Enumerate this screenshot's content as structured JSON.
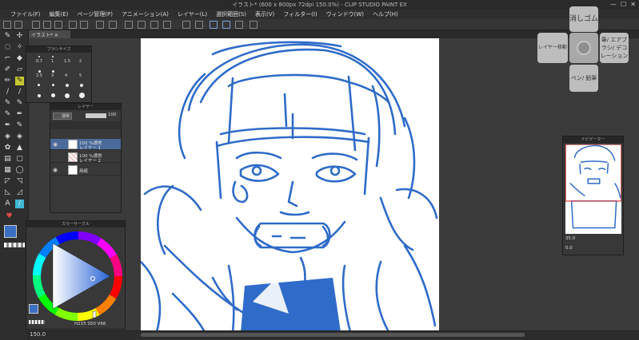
{
  "window": {
    "title": "イラスト* (600 x 800px 72dpi 150.0%) - CLIP STUDIO PAINT EX"
  },
  "menu": [
    "ファイル(F)",
    "編集(E)",
    "ページ管理(P)",
    "アニメーション(A)",
    "レイヤー(L)",
    "選択範囲(S)",
    "表示(V)",
    "フィルター(I)",
    "ウィンドウ(W)",
    "ヘルプ(H)"
  ],
  "doc_tab": "イラスト*",
  "brush_panel": {
    "title": "ブラシサイズ",
    "sizes": [
      "0.7",
      "1",
      "1.5",
      "2",
      "2.5",
      "3",
      "4",
      "5"
    ]
  },
  "layer_panel": {
    "title": "レイヤー",
    "blend": "通常",
    "opacity": "100",
    "layers": [
      {
        "percent": "100 %通常",
        "name": "レイヤー 1",
        "selected": true
      },
      {
        "percent": "100 %通常",
        "name": "レイヤー 2",
        "selected": false
      },
      {
        "percent": "",
        "name": "用紙",
        "selected": false
      }
    ]
  },
  "color_panel": {
    "title": "カラーサークル",
    "h": "215",
    "s": "50",
    "v": "66",
    "h_label": "H",
    "s_label": "S",
    "v_label": "V"
  },
  "nav_panel": {
    "title": "ナビゲーター",
    "zoom": "35.0",
    "rotate": "0.0"
  },
  "quick_access": {
    "top": "消しゴム",
    "left": "レイヤー移動",
    "right": "筆/ エアブラシ/ デコレーション",
    "bottom": "ペン/ 鉛筆"
  },
  "status": {
    "zoom": "150.0"
  },
  "colors": {
    "main": "#3a6fc4",
    "accent": "#c8c832"
  }
}
